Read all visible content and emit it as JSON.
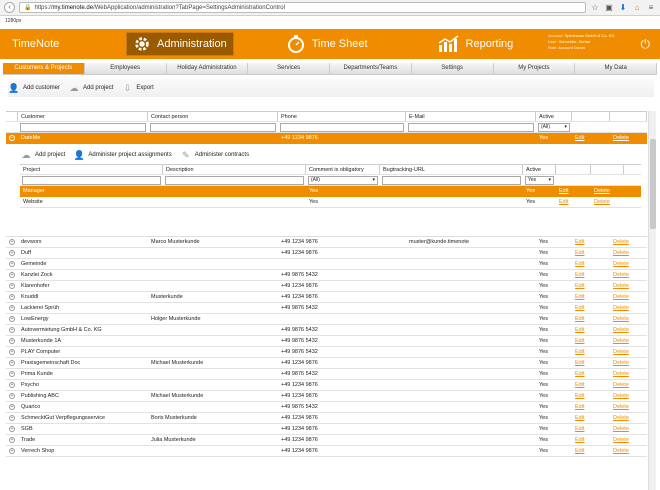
{
  "browser": {
    "url_host": "my.timenote.de",
    "url_prefix": "https://",
    "url_path": "/WebApplication/administration?TabPage=SettingsAdministrationControl",
    "size_label": "1280px"
  },
  "app": {
    "brand": "TimeNote",
    "modules": [
      {
        "label": "Administration",
        "icon": "gear-icon",
        "active": true
      },
      {
        "label": "Time Sheet",
        "icon": "stopwatch-icon",
        "active": false
      },
      {
        "label": "Reporting",
        "icon": "chart-icon",
        "active": false
      }
    ],
    "account": {
      "account_label": "Account:",
      "account_value": "Spieleiwas GmbH & Co. KG",
      "user_label": "User:",
      "user_value": "Schneider, Stefan",
      "role_label": "Role:",
      "role_value": "Account Owner"
    }
  },
  "tabs": [
    "Customers & Projects",
    "Employees",
    "Holiday Administration",
    "Services",
    "Departments/Teams",
    "Settings",
    "My Projects",
    "My Data"
  ],
  "toolbar": {
    "add_customer": "Add customer",
    "add_project": "Add project",
    "export": "Export"
  },
  "customer_table": {
    "columns": [
      "Customer",
      "Contact person",
      "Phone",
      "E-Mail",
      "Active"
    ],
    "active_filter": "(All)",
    "edit_label": "Edit",
    "delete_label": "Delete",
    "selected": {
      "customer": "DateMe",
      "contact": "",
      "phone": "+49 1234 9876",
      "email": "",
      "active": "Yes"
    },
    "rows": [
      {
        "customer": "devworx",
        "contact": "Marco Musterkunde",
        "phone": "+49 1234 9876",
        "email": "muster@kunde.timenote",
        "active": "Yes"
      },
      {
        "customer": "Duff",
        "contact": "",
        "phone": "+49 1234 9876",
        "email": "",
        "active": "Yes"
      },
      {
        "customer": "Gemeinde",
        "contact": "",
        "phone": "",
        "email": "",
        "active": "Yes"
      },
      {
        "customer": "Kanzlei Zock",
        "contact": "",
        "phone": "+49 9876 5432",
        "email": "",
        "active": "Yes"
      },
      {
        "customer": "Klarenhofer",
        "contact": "",
        "phone": "+49 1234 9876",
        "email": "",
        "active": "Yes"
      },
      {
        "customer": "Knuddl",
        "contact": "Musterkunde",
        "phone": "+49 1234 9876",
        "email": "",
        "active": "Yes"
      },
      {
        "customer": "Lackierei Sprüh",
        "contact": "",
        "phone": "+49 9876 5432",
        "email": "",
        "active": "Yes"
      },
      {
        "customer": "LowEnergy",
        "contact": "Holger Musterkunde",
        "phone": "",
        "email": "",
        "active": "Yes"
      },
      {
        "customer": "Autovermietung GmbH & Co. KG",
        "contact": "",
        "phone": "+49 9876 5432",
        "email": "",
        "active": "Yes"
      },
      {
        "customer": "Musterkunde 1A",
        "contact": "",
        "phone": "+49 9876 5432",
        "email": "",
        "active": "Yes"
      },
      {
        "customer": "PLAY Computer",
        "contact": "",
        "phone": "+49 9876 5432",
        "email": "",
        "active": "Yes"
      },
      {
        "customer": "Praxisgemeinschaft Doc",
        "contact": "Michael Musterkunde",
        "phone": "+49 1234 9876",
        "email": "",
        "active": "Yes"
      },
      {
        "customer": "Prima Kunde",
        "contact": "",
        "phone": "+49 9876 5432",
        "email": "",
        "active": "Yes"
      },
      {
        "customer": "Psycho",
        "contact": "",
        "phone": "+49 1234 9876",
        "email": "",
        "active": "Yes"
      },
      {
        "customer": "Publishing ABC",
        "contact": "Michael Musterkunde",
        "phone": "+49 1234 9876",
        "email": "",
        "active": "Yes"
      },
      {
        "customer": "Quarico",
        "contact": "",
        "phone": "+49 9876 5432",
        "email": "",
        "active": "Yes"
      },
      {
        "customer": "SchmecktGut Verpflegungsservice",
        "contact": "Boris Musterkunde",
        "phone": "+49 1234 9876",
        "email": "",
        "active": "Yes"
      },
      {
        "customer": "SGB",
        "contact": "",
        "phone": "+49 1234 9876",
        "email": "",
        "active": "Yes"
      },
      {
        "customer": "Trade",
        "contact": "Julia Musterkunde",
        "phone": "+49 1234 9876",
        "email": "",
        "active": "Yes"
      },
      {
        "customer": "Verrech Shop",
        "contact": "",
        "phone": "+49 1234 9876",
        "email": "",
        "active": "Yes"
      }
    ]
  },
  "project_table": {
    "toolbar": {
      "add_project": "Add project",
      "assignments": "Administer project assignments",
      "contracts": "Administer contracts"
    },
    "columns": [
      "Project",
      "Description",
      "Comment is obligatory",
      "Bugtracking-URL",
      "Active"
    ],
    "comment_filter": "(All)",
    "active_filter": "Yes",
    "rows": [
      {
        "project": "Manager",
        "description": "",
        "comment": "Yes",
        "url": "",
        "active": "Yes",
        "selected": true
      },
      {
        "project": "Website",
        "description": "",
        "comment": "Yes",
        "url": "",
        "active": "Yes",
        "selected": false
      }
    ]
  }
}
